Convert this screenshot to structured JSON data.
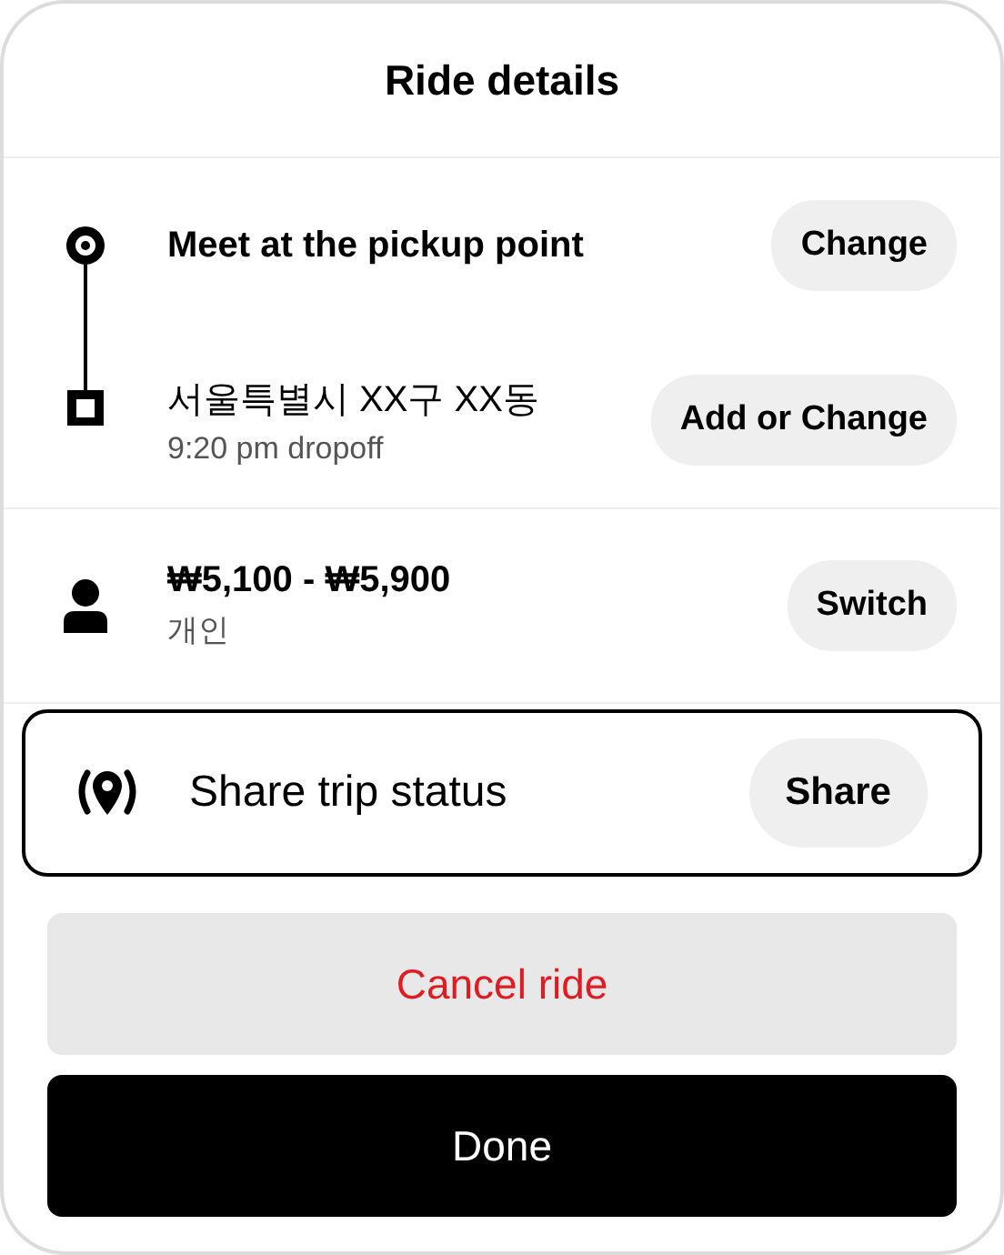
{
  "title": "Ride details",
  "route": [
    {
      "kind": "pickup",
      "label": "Meet at the pickup point",
      "button": "Change"
    },
    {
      "kind": "dropoff",
      "label": "서울특별시 XX구 XX동",
      "sublabel": "9:20 pm dropoff",
      "button": "Add or Change"
    }
  ],
  "fare": {
    "price": "₩5,100 - ₩5,900",
    "payment": "개인",
    "button": "Switch"
  },
  "share": {
    "label": "Share trip status",
    "button": "Share",
    "highlighted": true
  },
  "actions": [
    {
      "kind": "cancel",
      "label": "Cancel ride"
    },
    {
      "kind": "primary",
      "label": "Done"
    }
  ]
}
